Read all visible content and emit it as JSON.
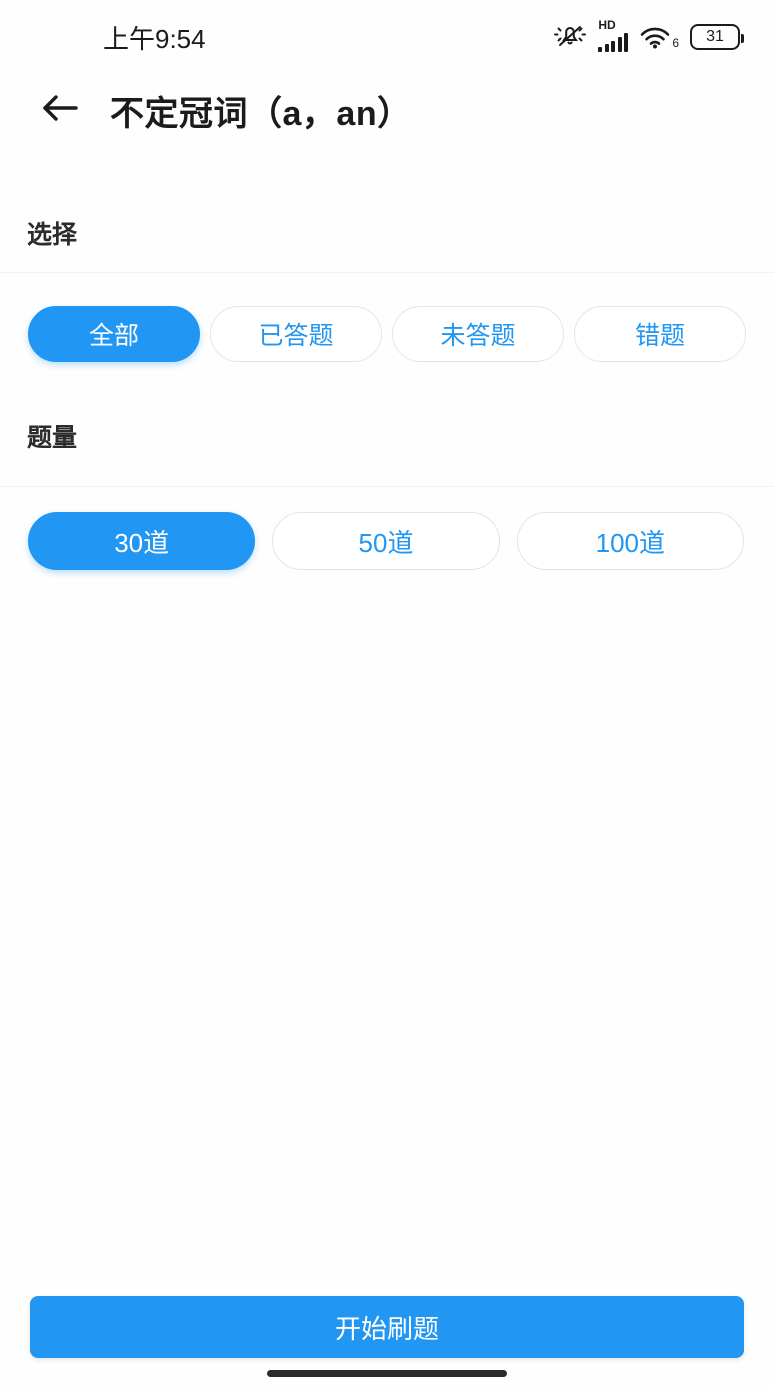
{
  "status_bar": {
    "time": "上午9:54",
    "mute_icon": "bell-muted-icon",
    "network_label": "HD",
    "signal_icon": "signal-bars-icon",
    "wifi_icon": "wifi-icon",
    "wifi_generation": "6",
    "battery_level": "31"
  },
  "header": {
    "back_icon": "back-arrow-icon",
    "title": "不定冠词（a，an）"
  },
  "sections": [
    {
      "label": "选择",
      "options": [
        {
          "label": "全部",
          "selected": true
        },
        {
          "label": "已答题",
          "selected": false
        },
        {
          "label": "未答题",
          "selected": false
        },
        {
          "label": "错题",
          "selected": false
        }
      ]
    },
    {
      "label": "题量",
      "options": [
        {
          "label": "30道",
          "selected": true
        },
        {
          "label": "50道",
          "selected": false
        },
        {
          "label": "100道",
          "selected": false
        }
      ]
    }
  ],
  "footer": {
    "start_label": "开始刷题"
  },
  "colors": {
    "accent": "#2196f3",
    "text_primary": "#1b1b1b",
    "border": "#e3e5e8",
    "divider": "#f1f2f4",
    "background": "#fefefe"
  }
}
